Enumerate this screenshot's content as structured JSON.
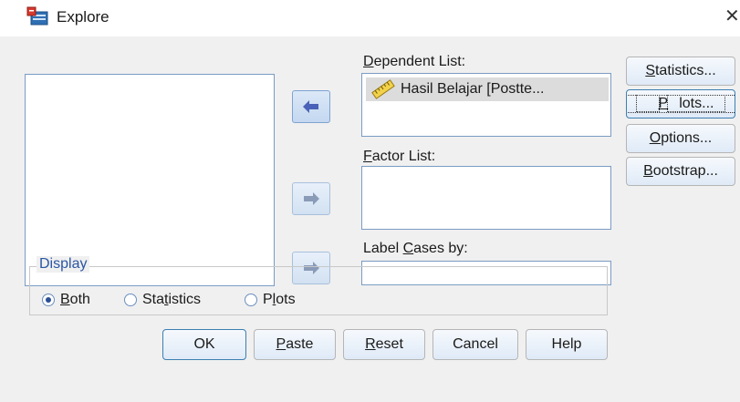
{
  "window": {
    "title": "Explore",
    "close_glyph": "✕",
    "icon": "explore-app-icon"
  },
  "source_list": {
    "items": []
  },
  "dependent": {
    "label_pre": "",
    "label_ul": "D",
    "label_post": "ependent List:",
    "items": [
      {
        "icon": "ruler-scale-icon",
        "text": "Hasil Belajar [Postte..."
      }
    ]
  },
  "factor": {
    "label_pre": "",
    "label_ul": "F",
    "label_post": "actor List:"
  },
  "label_cases": {
    "label_pre": "Label ",
    "label_ul": "C",
    "label_post": "ases by:"
  },
  "side_buttons": [
    {
      "pre": "",
      "ul": "S",
      "post": "tatistics..."
    },
    {
      "pre": "",
      "ul": "P",
      "post": "lots..."
    },
    {
      "pre": "",
      "ul": "O",
      "post": "ptions..."
    },
    {
      "pre": "",
      "ul": "B",
      "post": "ootstrap..."
    }
  ],
  "display": {
    "title": "Display",
    "options": [
      {
        "pre": "",
        "ul": "B",
        "post": "oth",
        "checked": true
      },
      {
        "pre": "Sta",
        "ul": "t",
        "post": "istics",
        "checked": false
      },
      {
        "pre": "P",
        "ul": "l",
        "post": "ots",
        "checked": false
      }
    ]
  },
  "bottom_buttons": [
    {
      "pre": "",
      "ul": "",
      "post": "OK"
    },
    {
      "pre": "",
      "ul": "P",
      "post": "aste"
    },
    {
      "pre": "",
      "ul": "R",
      "post": "eset"
    },
    {
      "pre": "Cancel",
      "ul": "",
      "post": ""
    },
    {
      "pre": "Help",
      "ul": "",
      "post": ""
    }
  ]
}
